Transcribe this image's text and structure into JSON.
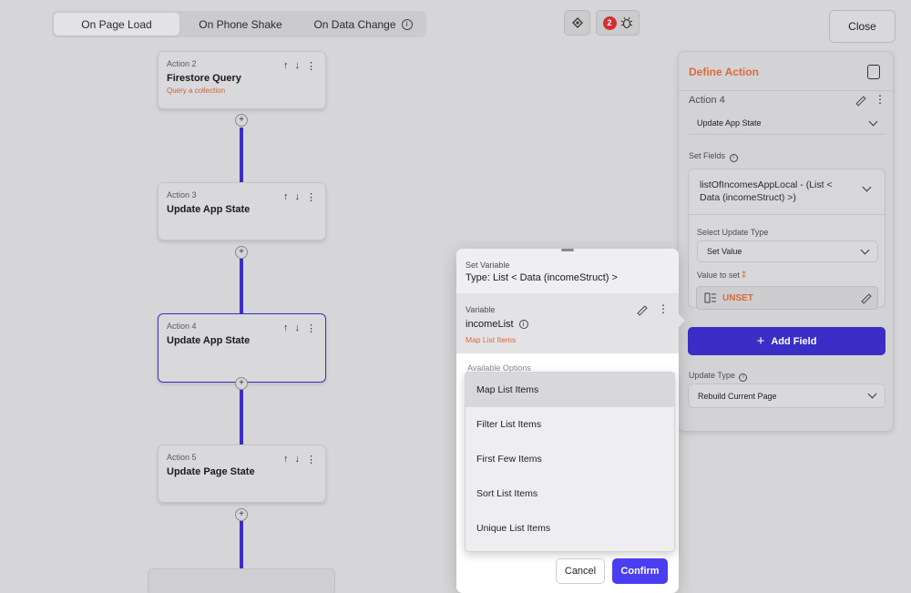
{
  "tabs": [
    {
      "label": "On Page Load",
      "active": true
    },
    {
      "label": "On Phone Shake",
      "active": false
    },
    {
      "label": "On Data Change",
      "active": false
    }
  ],
  "toolbar": {
    "error_count": "2",
    "close_label": "Close"
  },
  "actions": [
    {
      "num": "Action 2",
      "title": "Firestore Query",
      "subtitle": "Query a collection"
    },
    {
      "num": "Action 3",
      "title": "Update App State",
      "subtitle": ""
    },
    {
      "num": "Action 4",
      "title": "Update App State",
      "subtitle": ""
    },
    {
      "num": "Action 5",
      "title": "Update Page State",
      "subtitle": ""
    }
  ],
  "define": {
    "title": "Define Action",
    "action_label": "Action 4",
    "action_type": "Update App State",
    "set_fields_label": "Set Fields",
    "field_value": "listOfIncomesAppLocal - (List < Data (incomeStruct) >)",
    "select_update_type_label": "Select Update Type",
    "update_type_value": "Set Value",
    "value_to_set_label": "Value to set",
    "unset_label": "UNSET",
    "add_field_label": "Add Field",
    "update_type_label": "Update Type",
    "update_type_select": "Rebuild Current Page"
  },
  "popup": {
    "set_variable_label": "Set Variable",
    "type_label": "Type: List < Data (incomeStruct) >",
    "variable_label": "Variable",
    "variable_name": "incomeList",
    "variable_sub": "Map List Items",
    "available_label": "Available Options",
    "options": [
      "Map List Items",
      "Filter List Items",
      "First Few Items",
      "Sort List Items",
      "Unique List Items"
    ],
    "cancel_label": "Cancel",
    "confirm_label": "Confirm"
  },
  "colors": {
    "accent": "#3b2ec7",
    "orange": "#d96a3b",
    "confirm": "#4a3ef0",
    "error": "#d33030"
  }
}
